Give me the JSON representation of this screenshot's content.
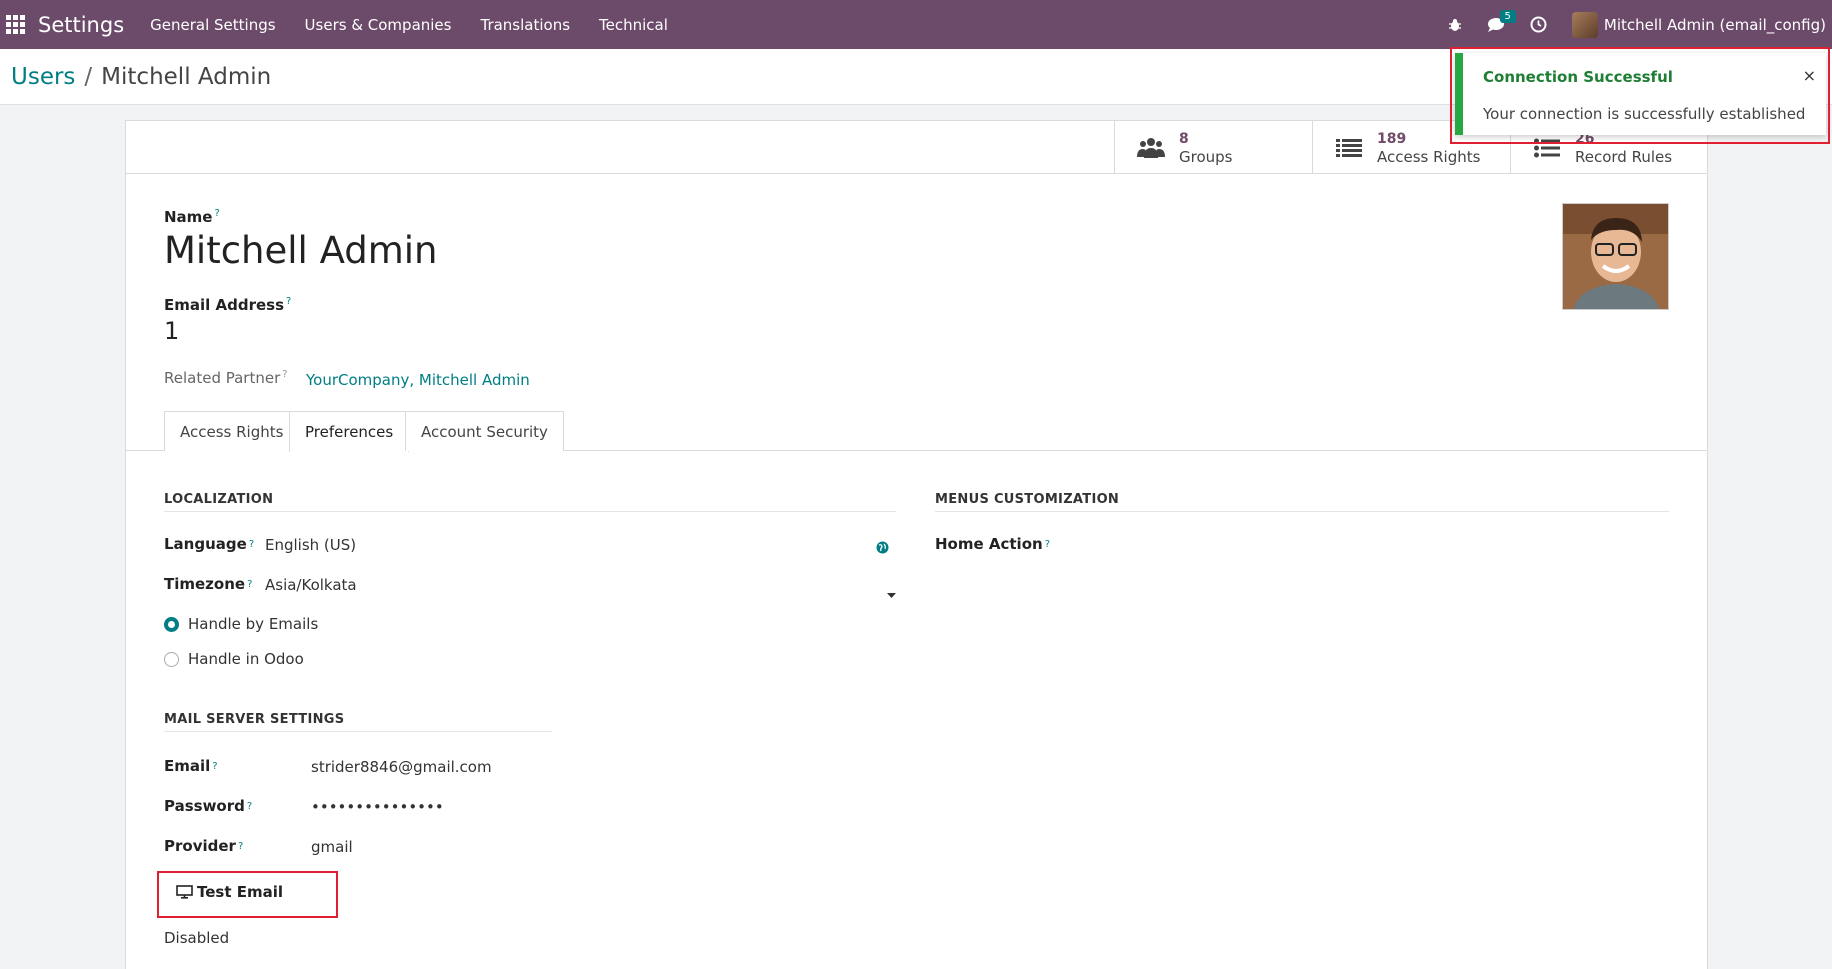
{
  "navbar": {
    "brand": "Settings",
    "menu": [
      "General Settings",
      "Users & Companies",
      "Translations",
      "Technical"
    ],
    "messages_badge": "5",
    "user_name": "Mitchell Admin (email_config)",
    "bg_color": "#6c4a69"
  },
  "breadcrumb": {
    "parent": "Users",
    "separator": "/",
    "current": "Mitchell Admin"
  },
  "stat_buttons": [
    {
      "value": "8",
      "label": "Groups",
      "icon": "users-icon"
    },
    {
      "value": "189",
      "label": "Access Rights",
      "icon": "list-icon"
    },
    {
      "value": "26",
      "label": "Record Rules",
      "icon": "list-bullets-icon"
    }
  ],
  "form": {
    "name_label": "Name",
    "name_value": "Mitchell Admin",
    "email_label": "Email Address",
    "email_value": "1",
    "partner_label": "Related Partner",
    "partner_value": "YourCompany, Mitchell Admin",
    "help_mark": "?"
  },
  "tabs": [
    {
      "label": "Access Rights",
      "active": false
    },
    {
      "label": "Preferences",
      "active": true
    },
    {
      "label": "Account Security",
      "active": false
    }
  ],
  "localization": {
    "title": "LOCALIZATION",
    "language_label": "Language",
    "language_value": "English (US)",
    "timezone_label": "Timezone",
    "timezone_value": "Asia/Kolkata",
    "notification_options": [
      {
        "label": "Handle by Emails",
        "selected": true
      },
      {
        "label": "Handle in Odoo",
        "selected": false
      }
    ]
  },
  "menus_customization": {
    "title": "MENUS CUSTOMIZATION",
    "home_action_label": "Home Action"
  },
  "mail_server": {
    "title": "MAIL SERVER SETTINGS",
    "email_label": "Email",
    "email_value": "strider8846@gmail.com",
    "password_label": "Password",
    "password_value": "•••••••••••••••",
    "provider_label": "Provider",
    "provider_value": "gmail",
    "test_button_label": "Test Email",
    "status_text": "Disabled"
  },
  "toast": {
    "title": "Connection Successful",
    "message": "Your connection is successfully established",
    "close": "×",
    "accent_color": "#28a745"
  },
  "colors": {
    "link": "#017e84",
    "highlight": "#e02030"
  }
}
